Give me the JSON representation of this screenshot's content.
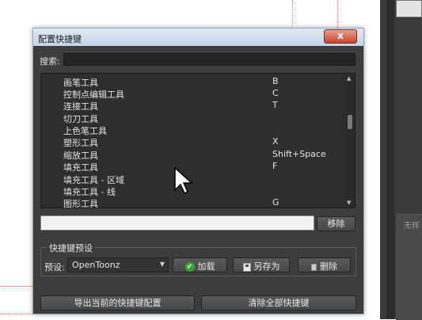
{
  "dialog": {
    "title": "配置快捷键",
    "close_label": "x",
    "search_label": "搜索:",
    "search_value": ""
  },
  "shortcuts": [
    {
      "name": "画笔工具",
      "key": "B"
    },
    {
      "name": "控制点编辑工具",
      "key": "C"
    },
    {
      "name": "连接工具",
      "key": "T"
    },
    {
      "name": "切刀工具",
      "key": ""
    },
    {
      "name": "上色笔工具",
      "key": ""
    },
    {
      "name": "塑形工具",
      "key": "X"
    },
    {
      "name": "缩放工具",
      "key": "Shift+Space"
    },
    {
      "name": "填充工具",
      "key": "F"
    },
    {
      "name": "填充工具 - 区域",
      "key": ""
    },
    {
      "name": "填充工具 - 线",
      "key": ""
    },
    {
      "name": "图形工具",
      "key": "G"
    }
  ],
  "shortcut_input": {
    "value": "",
    "remove_label": "移除"
  },
  "preset_group": {
    "title": "快捷键预设",
    "preset_label": "预设:",
    "preset_value": "OpenToonz",
    "load_label": "加载",
    "save_as_label": "另存为",
    "delete_label": "删除"
  },
  "footer": {
    "export_label": "导出当前的快捷键配置",
    "clear_label": "清除全部快捷键"
  },
  "background": {
    "side_label": "无样"
  },
  "colors": {
    "dialog_bg": "#3d3d3d",
    "title_bar": "#c4d5ea",
    "close_button": "#c8442e",
    "list_bg": "#2e2e2e",
    "check_green": "#3aa33a"
  }
}
